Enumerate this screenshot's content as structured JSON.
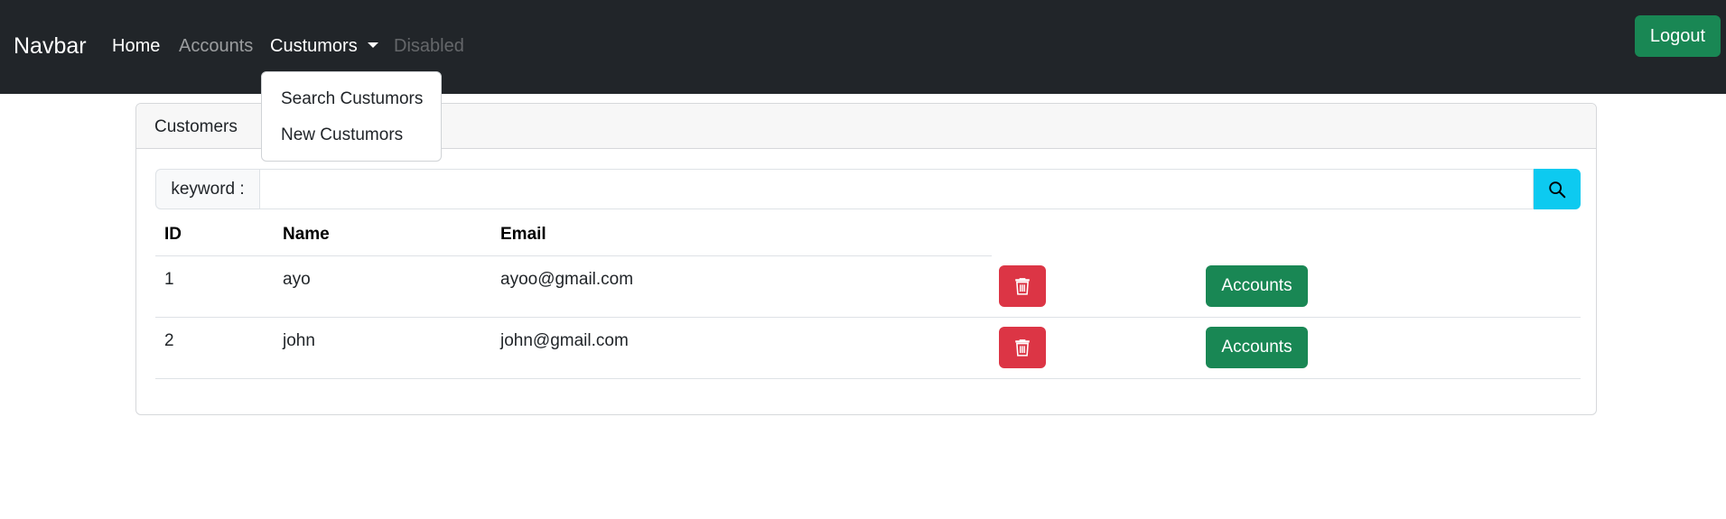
{
  "navbar": {
    "brand": "Navbar",
    "links": [
      "Home",
      "Accounts",
      "Custumors",
      "Disabled"
    ],
    "dropdown": [
      "Search Custumors",
      "New Custumors"
    ],
    "logout_label": "Logout"
  },
  "card": {
    "header": "Customers",
    "search": {
      "label": "keyword :",
      "value": "",
      "icon": "search-icon"
    },
    "table": {
      "columns": [
        "ID",
        "Name",
        "Email"
      ],
      "rows": [
        {
          "id": "1",
          "name": "ayo",
          "email": "ayoo@gmail.com",
          "accounts_label": "Accounts",
          "delete_icon": "trash-icon"
        },
        {
          "id": "2",
          "name": "john",
          "email": "john@gmail.com",
          "accounts_label": "Accounts",
          "delete_icon": "trash-icon"
        }
      ]
    }
  },
  "colors": {
    "navbar_bg": "#212529",
    "success": "#198754",
    "danger": "#dc3545",
    "info": "#0dcaf0"
  }
}
